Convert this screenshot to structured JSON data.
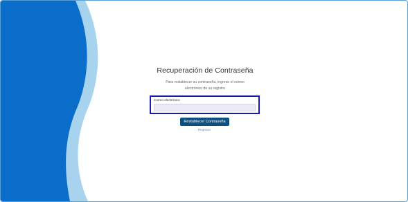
{
  "recovery": {
    "title": "Recuperación de Contraseña",
    "description": "Para restablecer su contraseña, ingrese el correo electrónico de su registro",
    "email_label": "Correo electrónico",
    "email_value": "",
    "email_placeholder": "",
    "submit_label": "Restablecer Contraseña",
    "back_link": "Regresar"
  },
  "colors": {
    "primary_blue": "#0a6dc9",
    "light_blue": "#a8d3ef",
    "button": "#0c4f80",
    "highlight_border": "#1a1aa8"
  }
}
